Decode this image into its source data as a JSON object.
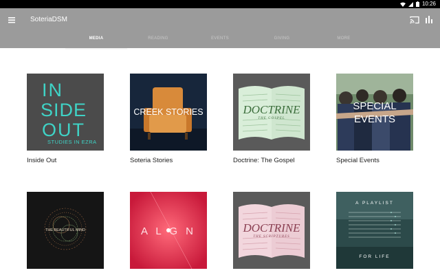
{
  "status": {
    "time": "10:26"
  },
  "appbar": {
    "title": "SoteriaDSM"
  },
  "tabs": [
    {
      "label": "MEDIA",
      "active": true
    },
    {
      "label": "READING",
      "active": false
    },
    {
      "label": "EVENTS",
      "active": false
    },
    {
      "label": "GIVING",
      "active": false
    },
    {
      "label": "MORE",
      "active": false
    }
  ],
  "cards": [
    {
      "label": "Inside Out",
      "art": {
        "line1": "IN",
        "line2": "SIDE",
        "line3": "OUT",
        "subtitle": "STUDIES IN EZRA",
        "accent": "#3fd3c6"
      }
    },
    {
      "label": "Soteria Stories",
      "art": {
        "text": "CREEK STORIES"
      }
    },
    {
      "label": "Doctrine: The Gospel",
      "art": {
        "title": "DOCTRINE",
        "subtitle": "THE GOSPEL"
      }
    },
    {
      "label": "Special Events",
      "art": {
        "line1": "SPECIAL",
        "line2": "EVENTS"
      }
    },
    {
      "label": "",
      "art": {
        "text": "THE BEAUTIFUL MIND"
      }
    },
    {
      "label": "",
      "art": {
        "text": "A L G N"
      }
    },
    {
      "label": "",
      "art": {
        "title": "DOCTRINE",
        "subtitle": "THE SCRIPTURES"
      }
    },
    {
      "label": "",
      "art": {
        "top": "A PLAYLIST",
        "bottom": "FOR LIFE"
      }
    }
  ]
}
